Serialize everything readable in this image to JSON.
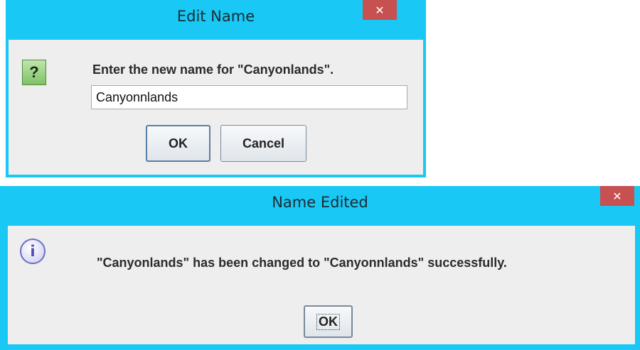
{
  "edit_dialog": {
    "title": "Edit Name",
    "close_glyph": "✕",
    "icon": "question-icon",
    "icon_glyph": "?",
    "prompt": "Enter the new name for \"Canyonlands\".",
    "input_value": "Canyonnlands",
    "ok_label": "OK",
    "cancel_label": "Cancel"
  },
  "result_dialog": {
    "title": "Name Edited",
    "close_glyph": "✕",
    "icon": "info-icon",
    "icon_glyph": "i",
    "message": "\"Canyonlands\" has been changed to \"Canyonnlands\" successfully.",
    "ok_label": "OK"
  },
  "colors": {
    "title_bar": "#19c8f5",
    "close_button": "#c75050",
    "dialog_body": "#eeeeee",
    "question_icon": "#8fcf78",
    "info_icon": "#6e6fc0"
  }
}
